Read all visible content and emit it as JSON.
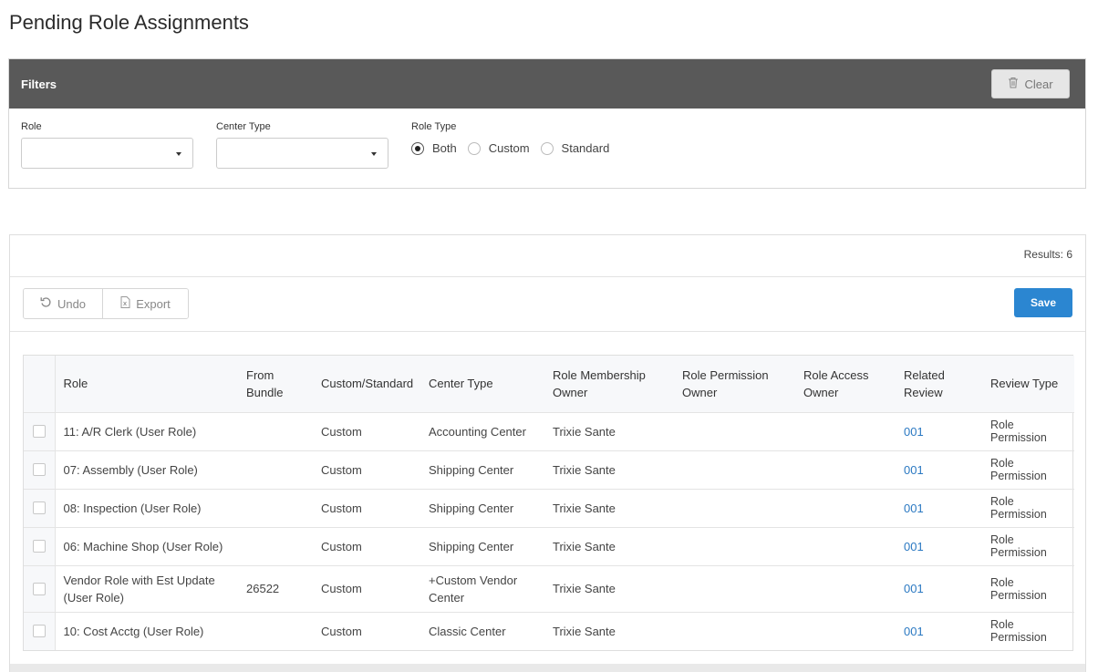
{
  "page": {
    "title": "Pending Role Assignments"
  },
  "filters": {
    "title": "Filters",
    "clear_label": "Clear",
    "role_label": "Role",
    "role_value": "",
    "center_type_label": "Center Type",
    "center_type_value": "",
    "role_type_label": "Role Type",
    "role_type_options": [
      "Both",
      "Custom",
      "Standard"
    ],
    "role_type_selected": "Both"
  },
  "results": {
    "count_text": "Results: 6",
    "undo_label": "Undo",
    "export_label": "Export",
    "save_label": "Save"
  },
  "table": {
    "columns": [
      "Role",
      "From Bundle",
      "Custom/Standard",
      "Center Type",
      "Role Membership Owner",
      "Role Permission Owner",
      "Role Access Owner",
      "Related Review",
      "Review Type"
    ],
    "rows": [
      {
        "role": "11: A/R Clerk (User Role)",
        "from_bundle": "",
        "custom_standard": "Custom",
        "center_type": "Accounting Center",
        "membership_owner": "Trixie Sante",
        "permission_owner": "",
        "access_owner": "",
        "related_review": "001",
        "review_type": "Role Permission"
      },
      {
        "role": "07: Assembly (User Role)",
        "from_bundle": "",
        "custom_standard": "Custom",
        "center_type": "Shipping Center",
        "membership_owner": "Trixie Sante",
        "permission_owner": "",
        "access_owner": "",
        "related_review": "001",
        "review_type": "Role Permission"
      },
      {
        "role": "08: Inspection (User Role)",
        "from_bundle": "",
        "custom_standard": "Custom",
        "center_type": "Shipping Center",
        "membership_owner": "Trixie Sante",
        "permission_owner": "",
        "access_owner": "",
        "related_review": "001",
        "review_type": "Role Permission"
      },
      {
        "role": "06: Machine Shop (User Role)",
        "from_bundle": "",
        "custom_standard": "Custom",
        "center_type": "Shipping Center",
        "membership_owner": "Trixie Sante",
        "permission_owner": "",
        "access_owner": "",
        "related_review": "001",
        "review_type": "Role Permission"
      },
      {
        "role": "Vendor Role with Est Update (User Role)",
        "from_bundle": "26522",
        "custom_standard": "Custom",
        "center_type": "+Custom Vendor Center",
        "membership_owner": "Trixie Sante",
        "permission_owner": "",
        "access_owner": "",
        "related_review": "001",
        "review_type": "Role Permission"
      },
      {
        "role": "10: Cost Acctg (User Role)",
        "from_bundle": "",
        "custom_standard": "Custom",
        "center_type": "Classic Center",
        "membership_owner": "Trixie Sante",
        "permission_owner": "",
        "access_owner": "",
        "related_review": "001",
        "review_type": "Role Permission"
      }
    ]
  }
}
